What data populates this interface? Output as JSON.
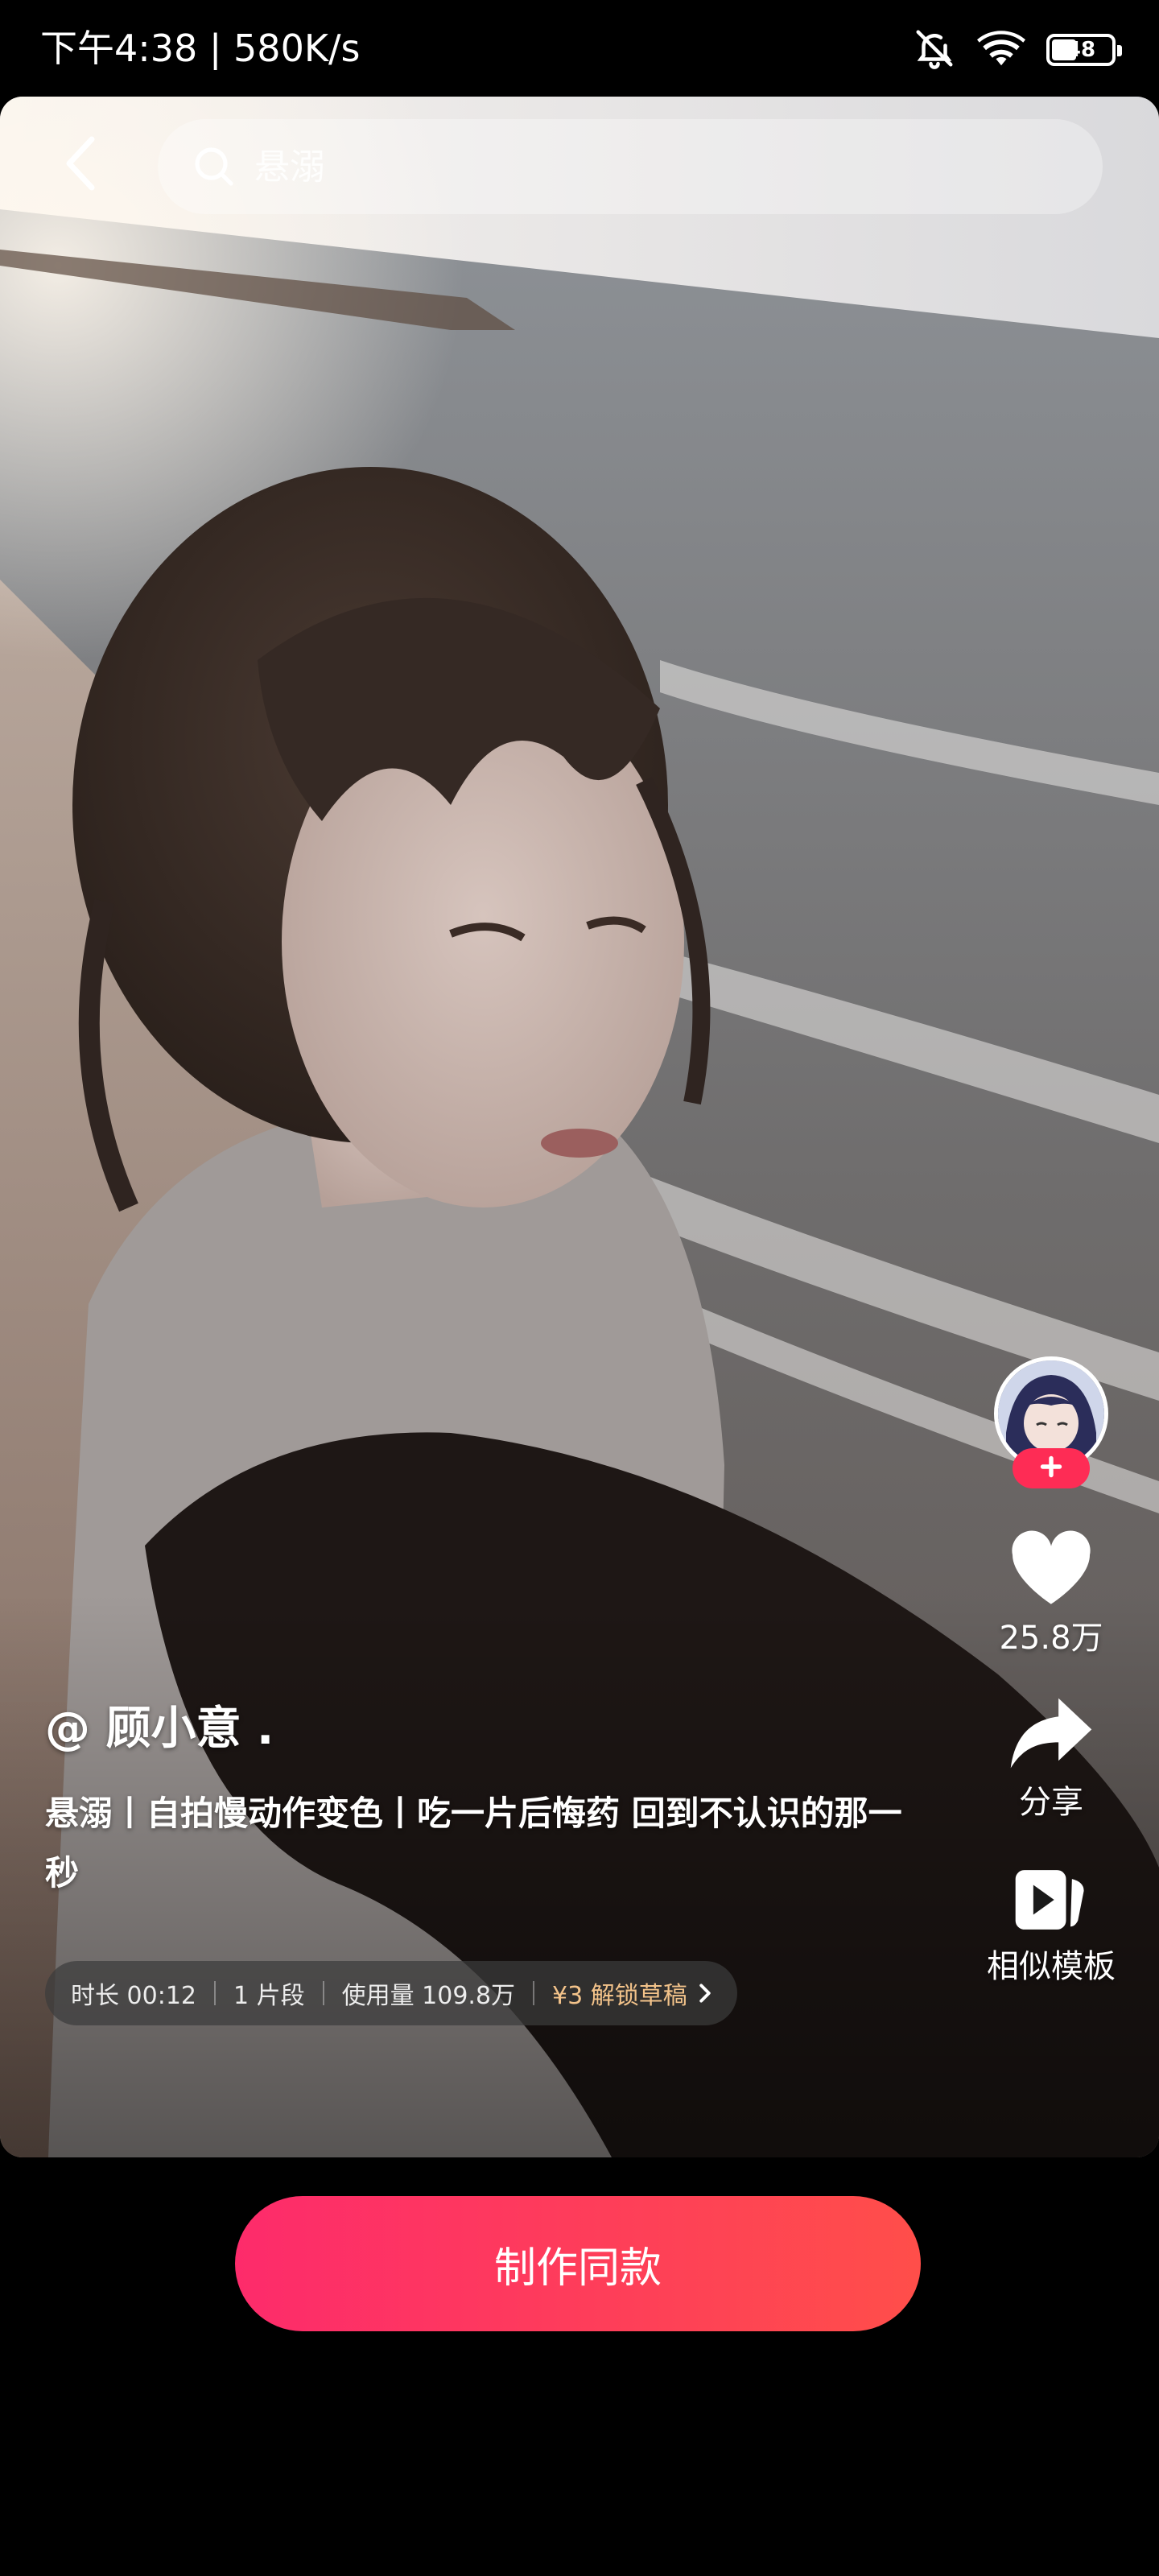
{
  "status_bar": {
    "time_speed": "下午4:38 | 580K/s",
    "battery_level": "48",
    "icons": [
      "bell-muted-icon",
      "wifi-icon",
      "battery-icon"
    ]
  },
  "top_bar": {
    "back_icon": "chevron-left-icon",
    "search_placeholder": "悬溺"
  },
  "creator": {
    "name": "@ 顾小意 .",
    "follow_icon": "plus-icon"
  },
  "actions": {
    "like_count": "25.8万",
    "share_label": "分享",
    "similar_label": "相似模板"
  },
  "video": {
    "title": "悬溺丨自拍慢动作变色丨吃一片后悔药 回到不认识的那一秒"
  },
  "meta": {
    "duration": "时长 00:12",
    "clips": "1 片段",
    "usage": "使用量 109.8万",
    "unlock": "¥3 解锁草稿"
  },
  "cta": {
    "label": "制作同款"
  },
  "colors": {
    "accent_pink": "#fe2c55",
    "cta_gradient_start": "#fd2b6b",
    "cta_gradient_end": "#ff4e4a",
    "unlock_gold": "#f3c38a"
  }
}
